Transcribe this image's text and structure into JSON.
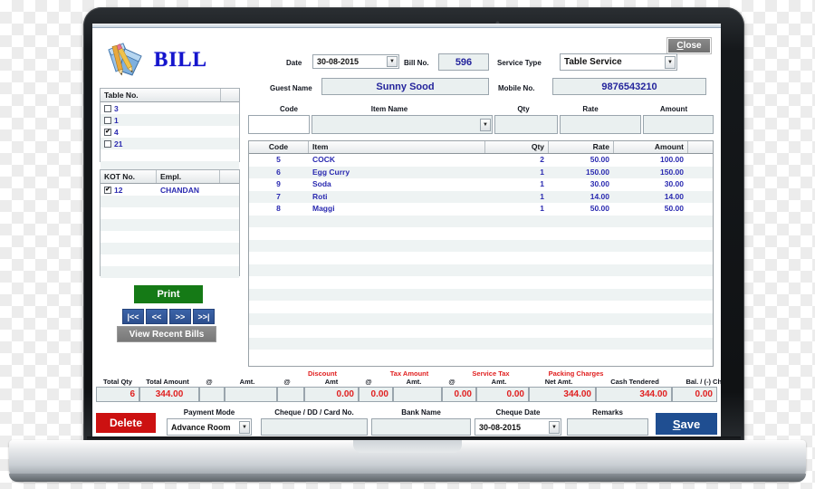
{
  "app": {
    "title": "BILL",
    "logo_icon": "notepad-pencils-icon",
    "close_label": "Close"
  },
  "header": {
    "date_label": "Date",
    "date_value": "30-08-2015",
    "bill_no_label": "Bill No.",
    "bill_no_value": "596",
    "service_type_label": "Service Type",
    "service_type_value": "Table Service",
    "guest_name_label": "Guest Name",
    "guest_name_value": "Sunny Sood",
    "mobile_label": "Mobile No.",
    "mobile_value": "9876543210"
  },
  "table_list": {
    "header": [
      "Table No.",
      ""
    ],
    "rows": [
      {
        "checked": false,
        "no": "3"
      },
      {
        "checked": false,
        "no": "1"
      },
      {
        "checked": true,
        "no": "4"
      },
      {
        "checked": false,
        "no": "21"
      },
      {
        "checked": null,
        "no": ""
      },
      {
        "checked": null,
        "no": ""
      },
      {
        "checked": null,
        "no": ""
      }
    ]
  },
  "kot_list": {
    "header": [
      "KOT No.",
      "Empl.",
      ""
    ],
    "rows": [
      {
        "checked": true,
        "no": "12",
        "empl": "CHANDAN"
      },
      {
        "checked": null,
        "no": "",
        "empl": ""
      },
      {
        "checked": null,
        "no": "",
        "empl": ""
      },
      {
        "checked": null,
        "no": "",
        "empl": ""
      },
      {
        "checked": null,
        "no": "",
        "empl": ""
      },
      {
        "checked": null,
        "no": "",
        "empl": ""
      },
      {
        "checked": null,
        "no": "",
        "empl": ""
      },
      {
        "checked": null,
        "no": "",
        "empl": ""
      }
    ]
  },
  "left_actions": {
    "print_label": "Print",
    "nav_first": "|<<",
    "nav_prev": "<<",
    "nav_next": ">>",
    "nav_last": ">>|",
    "recent_label": "View Recent Bills"
  },
  "entry": {
    "code_label": "Code",
    "item_name_label": "Item Name",
    "qty_label": "Qty",
    "rate_label": "Rate",
    "amount_label": "Amount",
    "code_value": "",
    "item_name_value": "",
    "qty_value": "",
    "rate_value": "",
    "amount_value": ""
  },
  "items_grid": {
    "columns": [
      "Code",
      "Item",
      "Qty",
      "Rate",
      "Amount",
      ""
    ],
    "rows": [
      {
        "code": "5",
        "item": "COCK",
        "qty": "2",
        "rate": "50.00",
        "amount": "100.00"
      },
      {
        "code": "6",
        "item": "Egg Curry",
        "qty": "1",
        "rate": "150.00",
        "amount": "150.00"
      },
      {
        "code": "9",
        "item": "Soda",
        "qty": "1",
        "rate": "30.00",
        "amount": "30.00"
      },
      {
        "code": "7",
        "item": "Roti",
        "qty": "1",
        "rate": "14.00",
        "amount": "14.00"
      },
      {
        "code": "8",
        "item": "Maggi",
        "qty": "1",
        "rate": "50.00",
        "amount": "50.00"
      },
      {
        "code": "",
        "item": "",
        "qty": "",
        "rate": "",
        "amount": ""
      },
      {
        "code": "",
        "item": "",
        "qty": "",
        "rate": "",
        "amount": ""
      },
      {
        "code": "",
        "item": "",
        "qty": "",
        "rate": "",
        "amount": ""
      },
      {
        "code": "",
        "item": "",
        "qty": "",
        "rate": "",
        "amount": ""
      },
      {
        "code": "",
        "item": "",
        "qty": "",
        "rate": "",
        "amount": ""
      },
      {
        "code": "",
        "item": "",
        "qty": "",
        "rate": "",
        "amount": ""
      },
      {
        "code": "",
        "item": "",
        "qty": "",
        "rate": "",
        "amount": ""
      },
      {
        "code": "",
        "item": "",
        "qty": "",
        "rate": "",
        "amount": ""
      },
      {
        "code": "",
        "item": "",
        "qty": "",
        "rate": "",
        "amount": ""
      },
      {
        "code": "",
        "item": "",
        "qty": "",
        "rate": "",
        "amount": ""
      },
      {
        "code": "",
        "item": "",
        "qty": "",
        "rate": "",
        "amount": ""
      },
      {
        "code": "",
        "item": "",
        "qty": "",
        "rate": "",
        "amount": ""
      }
    ]
  },
  "totals": {
    "group_discount": "Discount",
    "group_tax": "Tax Amount",
    "group_service_tax": "Service Tax",
    "group_packing": "Packing Charges",
    "total_qty_label": "Total Qty",
    "total_qty_value": "6",
    "total_amount_label": "Total Amount",
    "total_amount_value": "344.00",
    "discount_at_label": "@",
    "discount_at_value": "",
    "discount_amt_label": "Amt.",
    "discount_amt_value": "",
    "tax_at_label": "@",
    "tax_at_value": "",
    "tax_amt_label": "Amt",
    "tax_amt_value": "0.00",
    "stax_at_label": "@",
    "stax_at_value": "0.00",
    "stax_amt_label": "Amt.",
    "stax_amt_value": "",
    "pack_at_label": "@",
    "pack_at_value": "0.00",
    "pack_amt_label": "Amt.",
    "pack_amt_value": "0.00",
    "net_amt_label": "Net Amt.",
    "net_amt_value": "344.00",
    "cash_tendered_label": "Cash Tendered",
    "cash_tendered_value": "344.00",
    "balance_label": "Bal. / (-) Change",
    "balance_value": "0.00"
  },
  "footer": {
    "delete_label": "Delete",
    "payment_mode_label": "Payment Mode",
    "payment_mode_value": "Advance Room",
    "cheque_no_label": "Cheque / DD / Card No.",
    "cheque_no_value": "",
    "bank_name_label": "Bank Name",
    "bank_name_value": "",
    "cheque_date_label": "Cheque Date",
    "cheque_date_value": "30-08-2015",
    "remarks_label": "Remarks",
    "remarks_value": "",
    "save_label": "Save"
  },
  "colors": {
    "brand_blue": "#1414cc",
    "value_blue": "#24249c",
    "total_red": "#e02020",
    "print_green": "#157a16",
    "save_blue": "#1f4e91",
    "delete_red": "#cc1111"
  }
}
